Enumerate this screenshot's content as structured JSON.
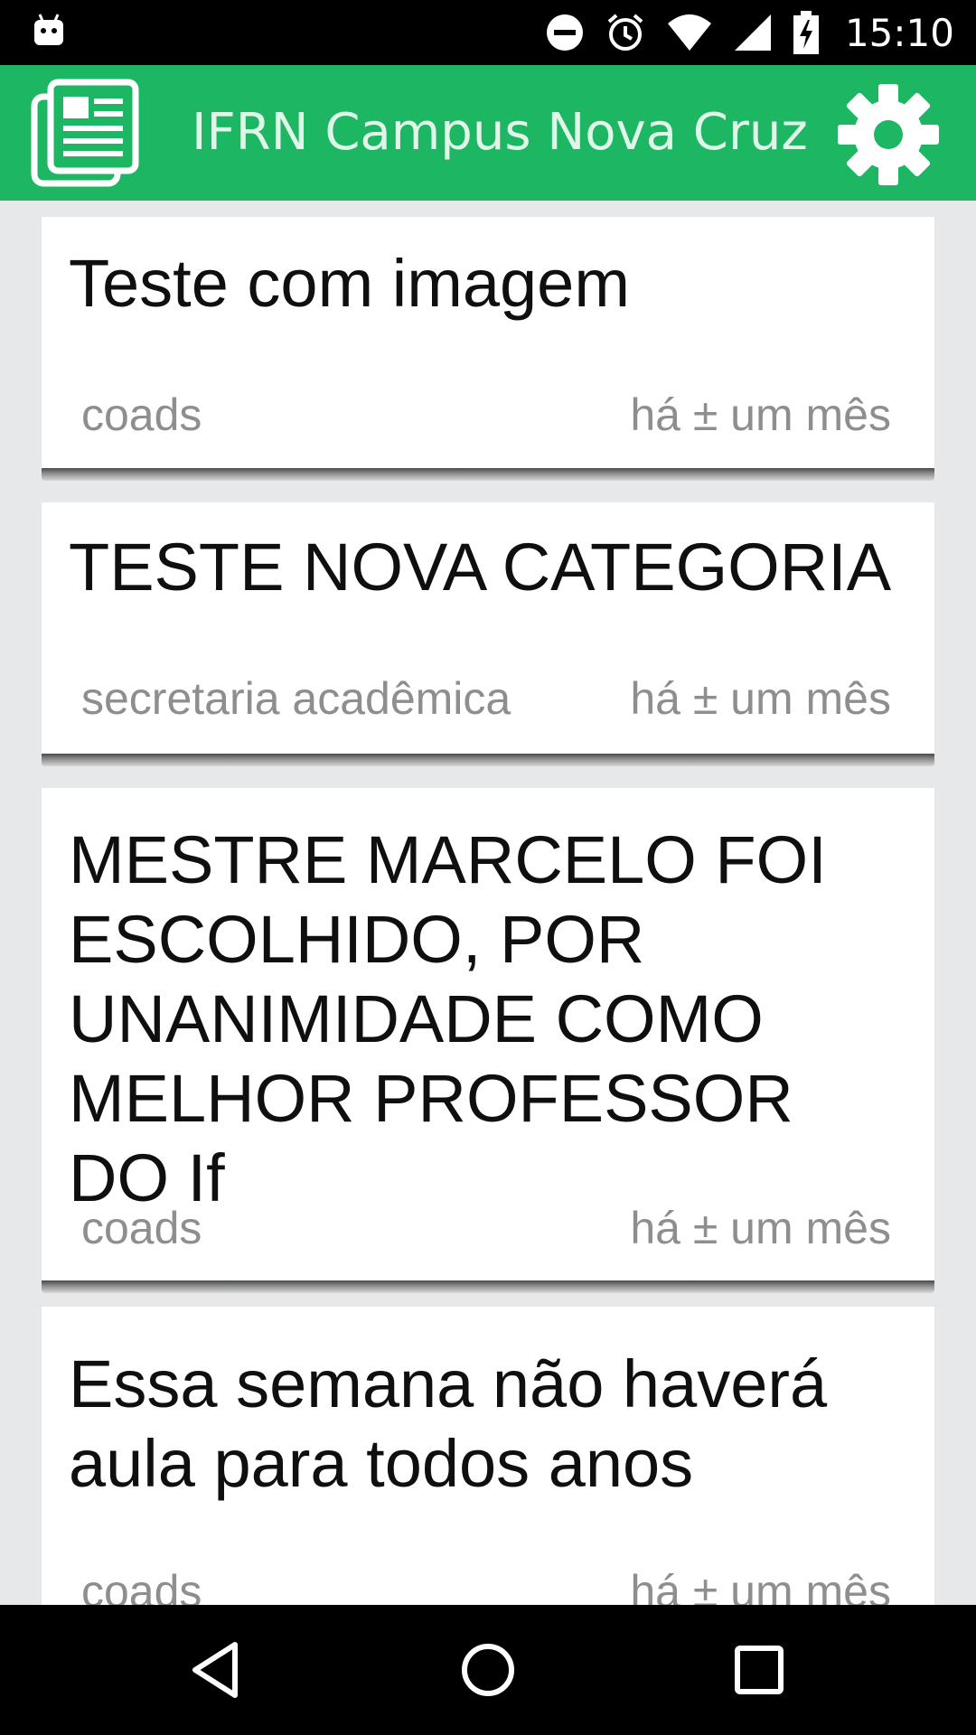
{
  "status_bar": {
    "time": "15:10",
    "icons": [
      "android-debug-icon",
      "do-not-disturb-icon",
      "alarm-icon",
      "wifi-icon",
      "cell-signal-icon",
      "battery-charging-icon"
    ]
  },
  "app_bar": {
    "title": "IFRN Campus Nova Cruz",
    "logo_icon": "news-icon",
    "settings_icon": "gear-icon",
    "background_color": "#1db663"
  },
  "feed": {
    "items": [
      {
        "title": "Teste com imagem",
        "category": "coads",
        "time": "há ± um mês"
      },
      {
        "title": "TESTE NOVA CATEGORIA",
        "category": "secretaria acadêmica",
        "time": "há ± um mês"
      },
      {
        "title": "MESTRE MARCELO FOI ESCOLHIDO, POR UNANIMIDADE COMO MELHOR PROFESSOR DO If",
        "category": "coads",
        "time": "há ± um mês"
      },
      {
        "title": "Essa semana não haverá aula para todos anos",
        "category": "coads",
        "time": "há ± um mês"
      }
    ]
  },
  "nav_bar": {
    "buttons": [
      "back-icon",
      "home-icon",
      "recents-icon"
    ]
  }
}
